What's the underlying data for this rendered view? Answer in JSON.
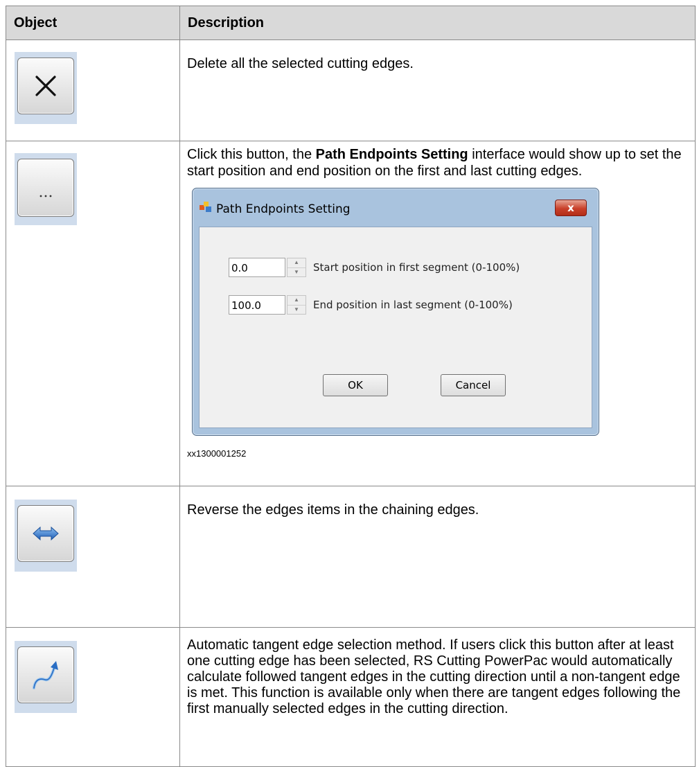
{
  "table": {
    "headers": {
      "object": "Object",
      "description": "Description"
    },
    "rows": [
      {
        "icon": "delete-x-icon",
        "description": "Delete all the selected cutting edges."
      },
      {
        "icon": "ellipsis-icon",
        "description_pre": "Click this button, the ",
        "description_bold": "Path Endpoints Setting",
        "description_post": " interface would show up to set the start position and end position on the first and last cutting edges.",
        "caption": "xx1300001252"
      },
      {
        "icon": "reverse-arrows-icon",
        "description": "Reverse the edges items in the chaining edges."
      },
      {
        "icon": "tangent-curve-icon",
        "description": "Automatic tangent edge selection method. If users click this button after at least one cutting edge has been selected, RS Cutting PowerPac would automatically calculate followed tangent edges in the cutting direction until a non-tangent edge is met. This function is available only when there are tangent edges following the first manually selected edges in the cutting direction."
      }
    ]
  },
  "dialog": {
    "title": "Path Endpoints Setting",
    "close_glyph": "x",
    "start_value": "0.0",
    "start_label": "Start position in first segment (0-100%)",
    "end_value": "100.0",
    "end_label": "End position in last segment (0-100%)",
    "ok_label": "OK",
    "cancel_label": "Cancel"
  },
  "colors": {
    "header_bg": "#d9d9d9",
    "icon_bg": "#cfdcec",
    "dialog_frame": "#a9c3de",
    "close_red": "#c9402a"
  }
}
